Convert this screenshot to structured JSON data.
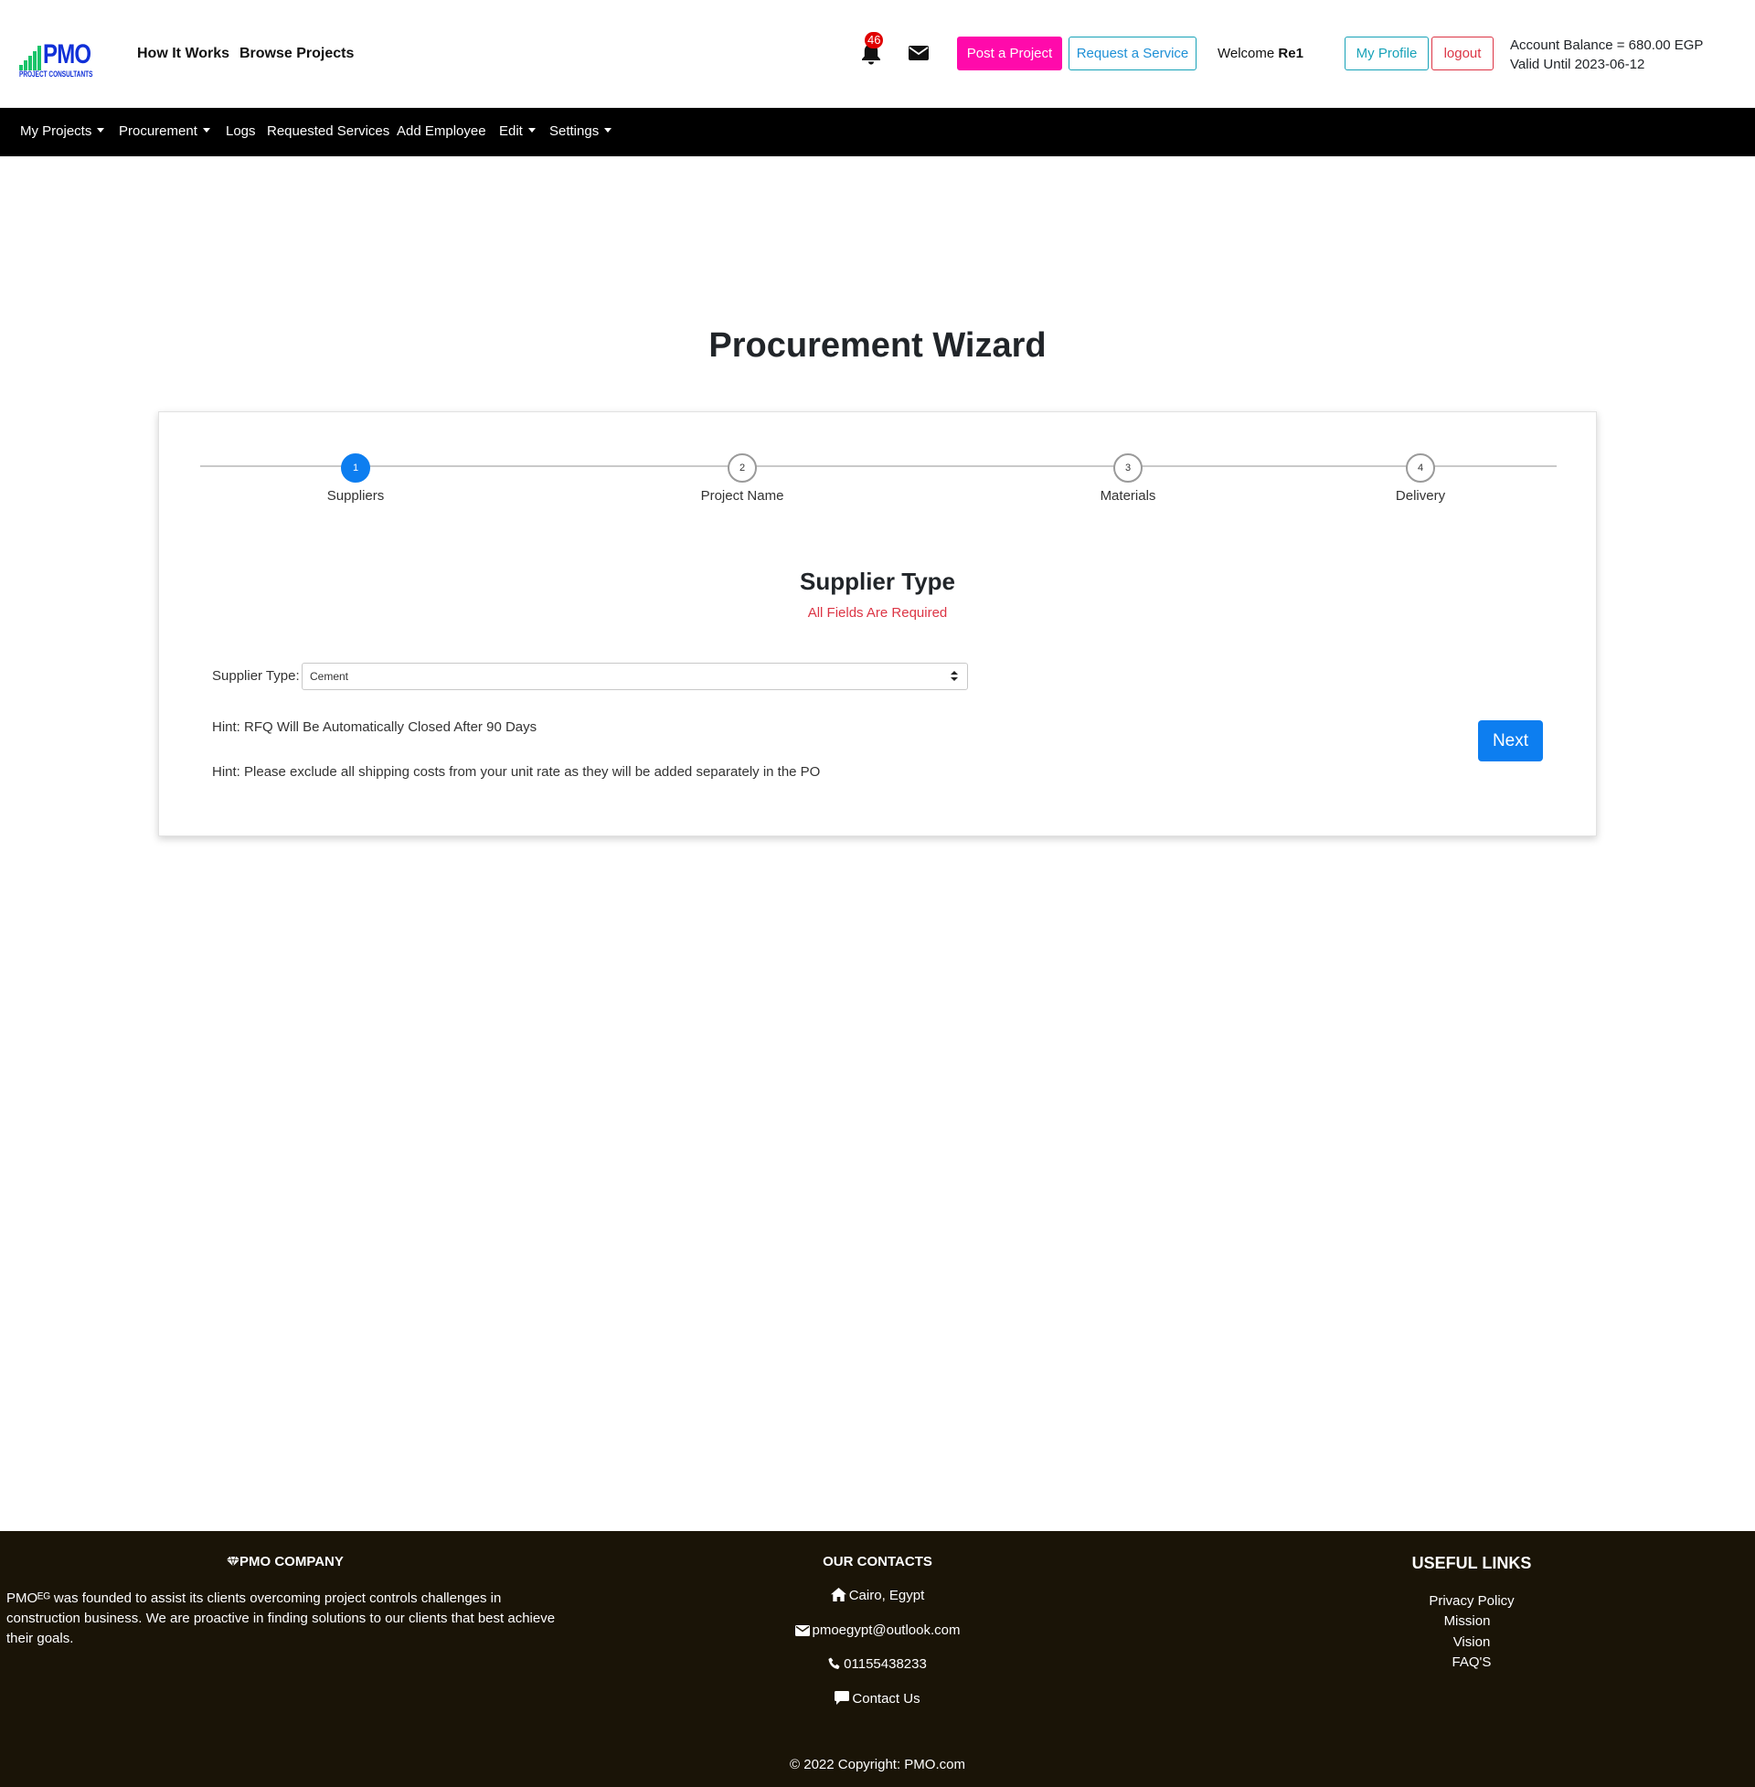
{
  "brand": {
    "name": "PMO",
    "tagline": "PROJECT CONSULTANTS"
  },
  "header": {
    "links": [
      "How It Works",
      "Browse Projects"
    ],
    "notifications_count": "46",
    "post_project": "Post a Project",
    "request_service": "Request a Service",
    "welcome_prefix": "Welcome",
    "username": "Re1",
    "my_profile": "My Profile",
    "logout": "logout",
    "account_balance": "Account Balance = 680.00 EGP",
    "valid_until": "Valid Until 2023-06-12"
  },
  "nav": {
    "items": [
      {
        "label": "My Projects",
        "dropdown": true
      },
      {
        "label": "Procurement",
        "dropdown": true
      },
      {
        "label": "Logs",
        "dropdown": false
      },
      {
        "label": "Requested Services",
        "dropdown": false
      },
      {
        "label": "Add Employee",
        "dropdown": false
      },
      {
        "label": "Edit",
        "dropdown": true
      },
      {
        "label": "Settings",
        "dropdown": true
      }
    ]
  },
  "main": {
    "title": "Procurement Wizard",
    "steps": [
      {
        "number": "1",
        "label": "Suppliers",
        "active": true
      },
      {
        "number": "2",
        "label": "Project Name",
        "active": false
      },
      {
        "number": "3",
        "label": "Materials",
        "active": false
      },
      {
        "number": "4",
        "label": "Delivery",
        "active": false
      }
    ],
    "section_title": "Supplier Type",
    "required_note": "All Fields Are Required",
    "supplier_type_label": "Supplier Type:",
    "supplier_type_value": "Cement",
    "hint_1": "Hint: RFQ Will Be Automatically Closed After 90 Days",
    "hint_2": "Hint: Please exclude all shipping costs from your unit rate as they will be added separately in the PO",
    "next_button": "Next"
  },
  "footer": {
    "company_heading": "PMO COMPANY",
    "company_text": "PMOᴱᴳ was founded to assist its clients overcoming project controls challenges in construction business. We are proactive in finding solutions to our clients that best achieve their goals.",
    "contacts_heading": "OUR CONTACTS",
    "location": "Cairo, Egypt",
    "email": "pmoegypt@outlook.com",
    "phone": "01155438233",
    "contact_us": "Contact Us",
    "links_heading": "USEFUL LINKS",
    "links": [
      "Privacy Policy",
      "Mission",
      "Vision",
      "FAQ'S"
    ],
    "copyright": "© 2022 Copyright: PMO.com"
  },
  "colors": {
    "primary": "#0d7ef0",
    "post_button": "#ff0aab",
    "info": "#17a2b8",
    "danger": "#dc3545",
    "nav_bg": "#000000",
    "footer_bg": "#1a1407"
  }
}
